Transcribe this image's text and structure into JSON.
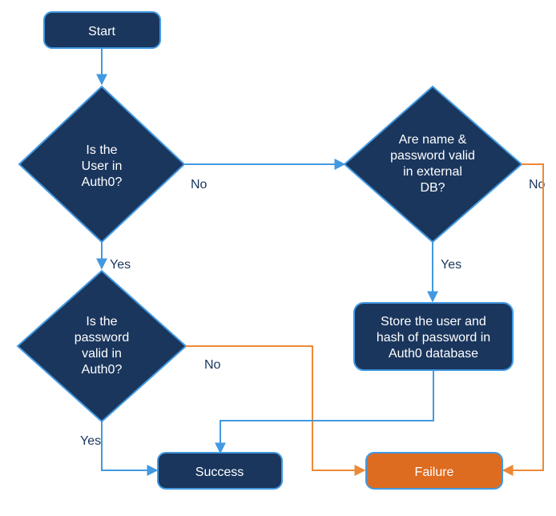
{
  "nodes": {
    "start": "Start",
    "d1_l1": "Is the",
    "d1_l2": "User in",
    "d1_l3": "Auth0?",
    "d2_l1": "Are name &",
    "d2_l2": "password valid",
    "d2_l3": "in external",
    "d2_l4": "DB?",
    "d3_l1": "Is the",
    "d3_l2": "password",
    "d3_l3": "valid in",
    "d3_l4": "Auth0?",
    "store_l1": "Store the user and",
    "store_l2": "hash of password in",
    "store_l3": "Auth0 database",
    "success": "Success",
    "failure": "Failure"
  },
  "labels": {
    "d1_no": "No",
    "d1_yes": "Yes",
    "d2_no": "No",
    "d2_yes": "Yes",
    "d3_no": "No",
    "d3_yes": "Yes"
  },
  "colors": {
    "nodeFill": "#1a365d",
    "nodeStroke": "#4299e1",
    "failureFill": "#dd6b20",
    "connectorBlue": "#4299e1",
    "connectorOrange": "#ed8936"
  }
}
